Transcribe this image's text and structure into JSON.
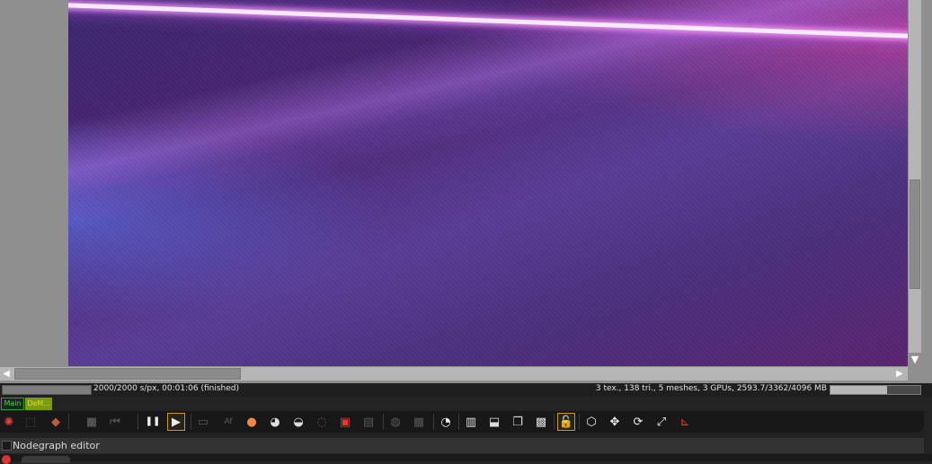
{
  "status": {
    "render_progress": 1.0,
    "render_text": "2000/2000 s/px, 00:01:06 (finished)",
    "scene_stats": "3 tex., 138 tri., 5 meshes, 3 GPUs, 2593.7/3362/4096 MB",
    "gpu_memory_fraction": 0.633
  },
  "tabs": {
    "main_label": "Main",
    "demo_label": "DeM..."
  },
  "nodegraph": {
    "label": "Nodegraph editor"
  },
  "glyphs": {
    "arrow_left": "◀",
    "arrow_right": "▶",
    "arrow_down": "▼",
    "pause": "❚❚",
    "play": "▶",
    "stop": "■",
    "rewind": "⏮",
    "lock": "🔓",
    "move": "✥",
    "refresh": "⟳",
    "expand": "⤢",
    "cube": "⬡",
    "axes": "⊾",
    "gauge": "◔",
    "monitor": "▭",
    "grid": "▦"
  },
  "colors": {
    "main_tab": "#3ddc3d",
    "demo_tab": "#7a9a10",
    "active_button_border": "#c69a22"
  }
}
